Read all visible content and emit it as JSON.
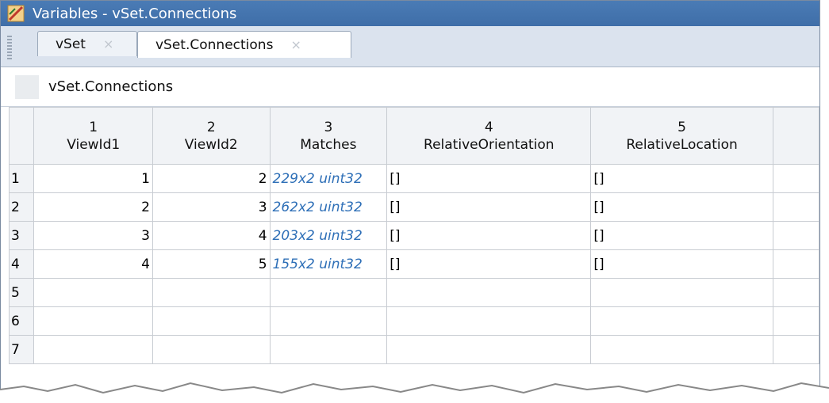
{
  "window": {
    "title": "Variables - vSet.Connections"
  },
  "tabs": [
    {
      "label": "vSet",
      "close": "×"
    },
    {
      "label": "vSet.Connections",
      "close": "×"
    }
  ],
  "path": {
    "text": "vSet.Connections"
  },
  "table": {
    "columns": [
      {
        "index": "1",
        "name": "ViewId1"
      },
      {
        "index": "2",
        "name": "ViewId2"
      },
      {
        "index": "3",
        "name": "Matches"
      },
      {
        "index": "4",
        "name": "RelativeOrientation"
      },
      {
        "index": "5",
        "name": "RelativeLocation"
      }
    ],
    "rows": [
      {
        "n": "1",
        "viewid1": "1",
        "viewid2": "2",
        "matches": "229x2 uint32",
        "orient": "[]",
        "loc": "[]"
      },
      {
        "n": "2",
        "viewid1": "2",
        "viewid2": "3",
        "matches": "262x2 uint32",
        "orient": "[]",
        "loc": "[]"
      },
      {
        "n": "3",
        "viewid1": "3",
        "viewid2": "4",
        "matches": "203x2 uint32",
        "orient": "[]",
        "loc": "[]"
      },
      {
        "n": "4",
        "viewid1": "4",
        "viewid2": "5",
        "matches": "155x2 uint32",
        "orient": "[]",
        "loc": "[]"
      },
      {
        "n": "5",
        "viewid1": "",
        "viewid2": "",
        "matches": "",
        "orient": "",
        "loc": ""
      },
      {
        "n": "6",
        "viewid1": "",
        "viewid2": "",
        "matches": "",
        "orient": "",
        "loc": ""
      },
      {
        "n": "7",
        "viewid1": "",
        "viewid2": "",
        "matches": "",
        "orient": "",
        "loc": ""
      }
    ]
  },
  "colors": {
    "titlebar": "#4a7bb5",
    "link": "#2e6fb7",
    "header_bg": "#f1f3f6"
  }
}
